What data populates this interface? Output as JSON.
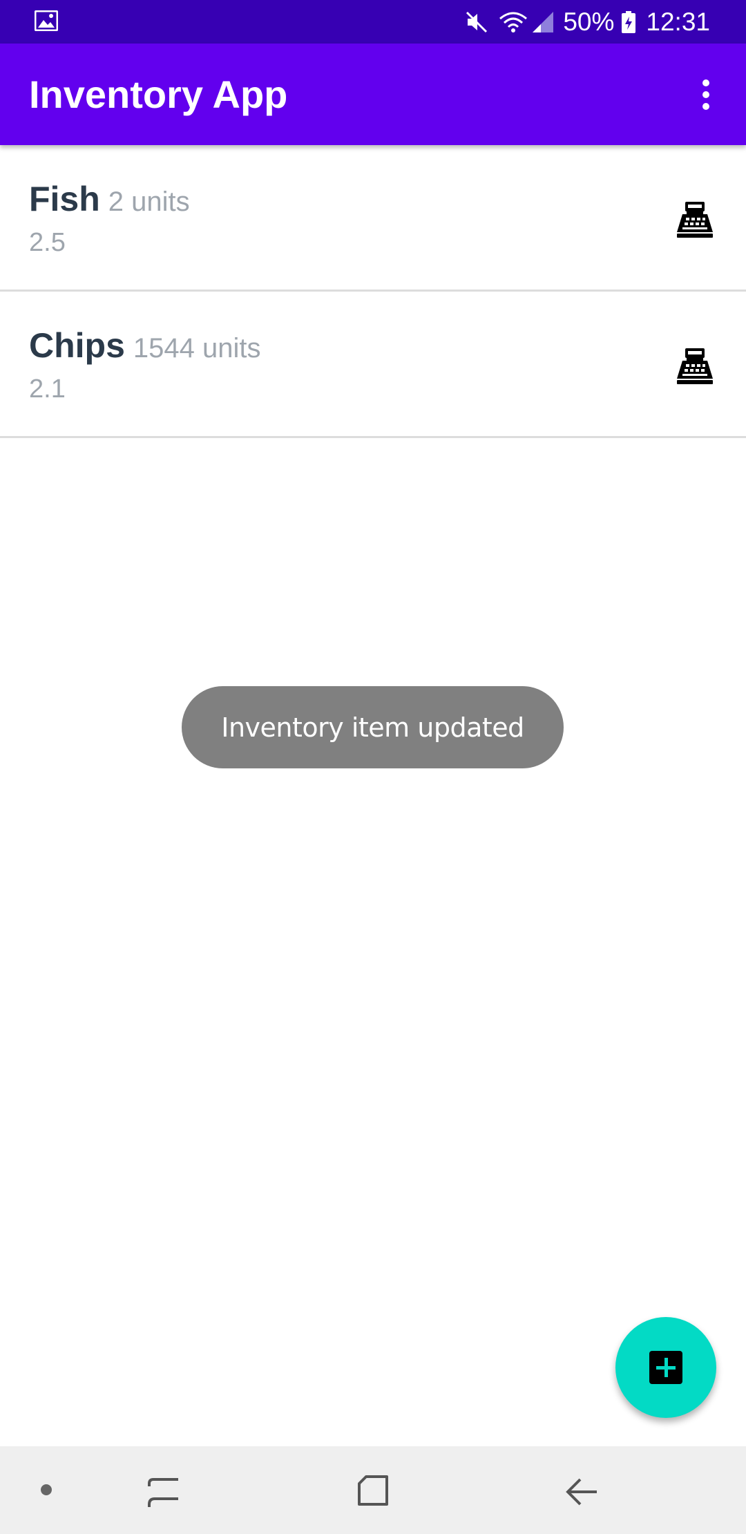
{
  "status_bar": {
    "battery_percent": "50%",
    "time": "12:31",
    "icons": [
      "gallery-icon",
      "mute-icon",
      "wifi-icon",
      "signal-icon",
      "battery-icon"
    ]
  },
  "app_bar": {
    "title": "Inventory App",
    "menu_icon": "overflow-menu-icon"
  },
  "items": [
    {
      "name": "Fish",
      "quantity": "2 units",
      "price": "2.5",
      "action_icon": "cash-register-icon"
    },
    {
      "name": "Chips",
      "quantity": "1544 units",
      "price": "2.1",
      "action_icon": "cash-register-icon"
    }
  ],
  "toast": {
    "message": "Inventory item updated"
  },
  "fab": {
    "icon": "add-box-icon",
    "color": "#03dac5"
  },
  "nav_bar": {
    "icons": [
      "dot-icon",
      "recent-apps-icon",
      "home-icon",
      "back-icon"
    ]
  },
  "colors": {
    "status_bar": "#3700b3",
    "app_bar": "#6200ee",
    "accent": "#03dac5"
  }
}
